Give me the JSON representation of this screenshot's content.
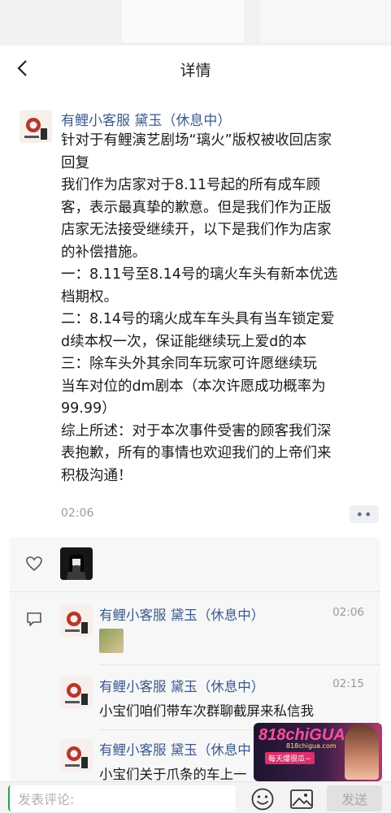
{
  "nav": {
    "title": "详情"
  },
  "post": {
    "author": "有鲤小客服 黛玉（休息中）",
    "lines": [
      "针对于有鲤演艺剧场“璃火”版权被收回店家",
      "回复",
      "我们作为店家对于8.11号起的所有成车顾",
      "客，表示最真挚的歉意。但是我们作为正版",
      "店家无法接受继续开，以下是我们作为店家",
      "的补偿措施。",
      "一：8.11号至8.14号的璃火车头有新本优选",
      "档期权。",
      "二：8.14号的璃火成车车头具有当车锁定爱",
      "d续本权一次，保证能继续玩上爱d的本",
      "三：除车头外其余同车玩家可许愿继续玩",
      "当车对位的dm剧本（本次许愿成功概率为",
      "99.99）",
      "综上所述：对于本次事件受害的顾客我们深",
      "表抱歉，所有的事情也欢迎我们的上帝们来",
      "积极沟通！"
    ],
    "time": "02:06",
    "more_label": "••"
  },
  "comments": [
    {
      "name": "有鲤小客服 黛玉（休息中）",
      "time": "02:06",
      "text": ""
    },
    {
      "name": "有鲤小客服 黛玉（休息中）",
      "time": "02:15",
      "text": "小宝们咱们带车次群聊截屏来私信我"
    },
    {
      "name": "有鲤小客服 黛玉（休息中",
      "time": "",
      "text": "小宝们关于爪条的车上一"
    }
  ],
  "promo": {
    "brand": "818chiGUA",
    "sub": "818chigua.com",
    "slogan": "每天爆很瓜~"
  },
  "bottom": {
    "placeholder": "发表评论:",
    "send_label": "发送"
  },
  "icons": {
    "back": "chevron-left-icon",
    "like": "heart-icon",
    "comment": "comment-bubble-icon",
    "emoji": "smiley-icon",
    "image": "image-icon"
  },
  "colors": {
    "link_name": "#3b5a8e",
    "comment_bg": "#f7f7f7",
    "send_disabled_bg": "#e1e1e1"
  }
}
